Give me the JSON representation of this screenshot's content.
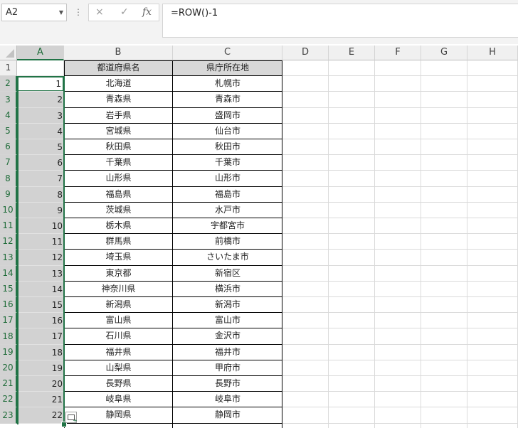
{
  "formula_bar": {
    "name_box": "A2",
    "cancel_icon": "×",
    "enter_icon": "✓",
    "fx_label": "fx",
    "formula": "=ROW()-1"
  },
  "columns": [
    "A",
    "B",
    "C",
    "D",
    "E",
    "F",
    "G",
    "H"
  ],
  "rows": [
    "1",
    "2",
    "3",
    "4",
    "5",
    "6",
    "7",
    "8",
    "9",
    "10",
    "11",
    "12",
    "13",
    "14",
    "15",
    "16",
    "17",
    "18",
    "19",
    "20",
    "21",
    "22",
    "23"
  ],
  "table": {
    "headers": [
      "都道府県名",
      "県庁所在地"
    ],
    "numbers": [
      "1",
      "2",
      "3",
      "4",
      "5",
      "6",
      "7",
      "8",
      "9",
      "10",
      "11",
      "12",
      "13",
      "14",
      "15",
      "16",
      "17",
      "18",
      "19",
      "20",
      "21",
      "22"
    ],
    "prefectures": [
      "北海道",
      "青森県",
      "岩手県",
      "宮城県",
      "秋田県",
      "千葉県",
      "山形県",
      "福島県",
      "茨城県",
      "栃木県",
      "群馬県",
      "埼玉県",
      "東京都",
      "神奈川県",
      "新潟県",
      "富山県",
      "石川県",
      "福井県",
      "山梨県",
      "長野県",
      "岐阜県",
      "静岡県"
    ],
    "capitals": [
      "札幌市",
      "青森市",
      "盛岡市",
      "仙台市",
      "秋田市",
      "千葉市",
      "山形市",
      "福島市",
      "水戸市",
      "宇都宮市",
      "前橋市",
      "さいたま市",
      "新宿区",
      "横浜市",
      "新潟市",
      "富山市",
      "金沢市",
      "福井市",
      "甲府市",
      "長野市",
      "岐阜市",
      "静岡市"
    ]
  },
  "colors": {
    "accent": "#217346",
    "selection_fill": "#d2d2d2",
    "header_fill": "#f0f0f0"
  },
  "icons": {
    "cancel": "close-icon",
    "enter": "check-icon",
    "function": "function-icon",
    "quick_analysis": "quick-analysis-icon"
  }
}
